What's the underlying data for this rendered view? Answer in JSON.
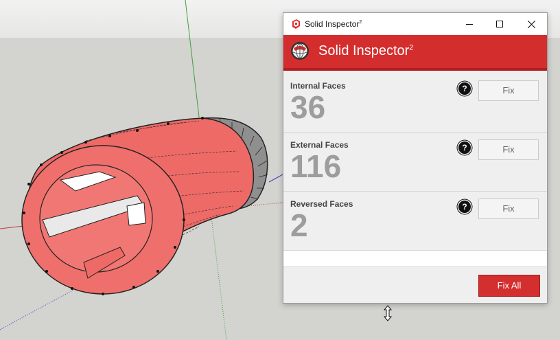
{
  "window": {
    "title": "Solid Inspector",
    "title_sup": "2",
    "controls": {
      "minimize": "minimize-icon",
      "maximize": "maximize-icon",
      "close": "close-icon"
    }
  },
  "banner": {
    "title": "Solid Inspector",
    "title_sup": "2"
  },
  "sections": [
    {
      "label": "Internal Faces",
      "count": "36",
      "help": "?",
      "fix_label": "Fix"
    },
    {
      "label": "External Faces",
      "count": "116",
      "help": "?",
      "fix_label": "Fix"
    },
    {
      "label": "Reversed Faces",
      "count": "2",
      "help": "?",
      "fix_label": "Fix"
    }
  ],
  "footer": {
    "fix_all_label": "Fix All"
  },
  "colors": {
    "brand_red": "#d42d2d",
    "model_red": "#ee6a66",
    "model_gray": "#8c8c8c"
  }
}
